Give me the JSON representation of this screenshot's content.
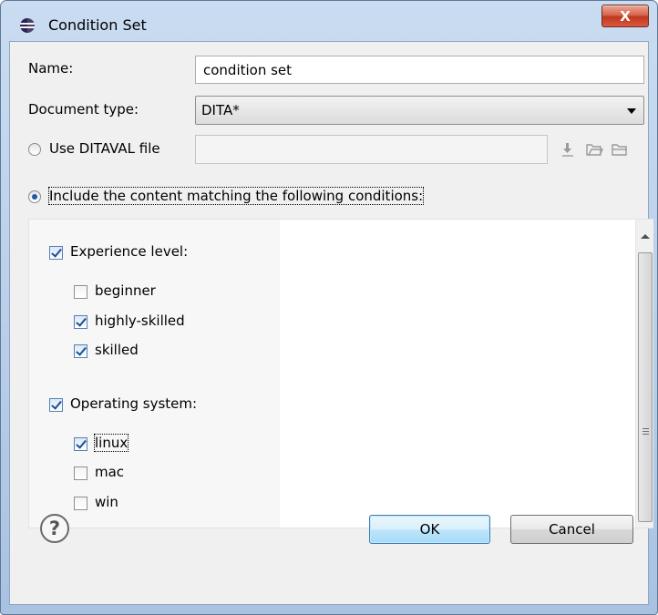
{
  "window": {
    "title": "Condition Set",
    "close_label": "X"
  },
  "form": {
    "name_label": "Name:",
    "name_value": "condition set",
    "doctype_label": "Document type:",
    "doctype_value": "DITA*",
    "ditaval_label": "Use DITAVAL file",
    "ditaval_value": "",
    "include_label": "Include the content matching the following conditions:",
    "ditaval_selected": false,
    "include_selected": true
  },
  "conditions": {
    "groups": [
      {
        "label": "Experience level:",
        "checked": true,
        "items": [
          {
            "label": "beginner",
            "checked": false
          },
          {
            "label": "highly-skilled",
            "checked": true
          },
          {
            "label": "skilled",
            "checked": true
          }
        ]
      },
      {
        "label": "Operating system:",
        "checked": true,
        "items": [
          {
            "label": "linux",
            "checked": true
          },
          {
            "label": "mac",
            "checked": false
          },
          {
            "label": "win",
            "checked": false
          }
        ]
      }
    ]
  },
  "icons": {
    "title": "eclipse-icon",
    "toolbar": [
      "download-icon",
      "open-folder-icon",
      "browse-folder-icon"
    ],
    "help": "help-icon"
  },
  "buttons": {
    "help_glyph": "?",
    "ok_label": "OK",
    "cancel_label": "Cancel"
  },
  "colors": {
    "accent": "#1c5aa8",
    "close_button": "#c0371e",
    "default_button": "#3c7fb1"
  }
}
